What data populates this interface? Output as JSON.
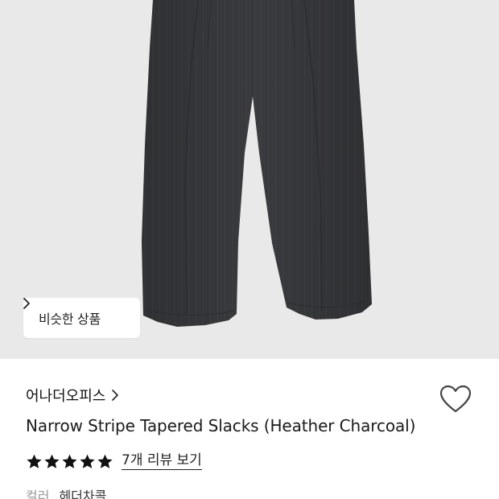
{
  "hero": {
    "similar_button_label": "비슷한 상품"
  },
  "product": {
    "brand": "어나더오피스",
    "title": "Narrow Stripe Tapered Slacks (Heather Charcoal)",
    "rating": 5,
    "review_link": "7개 리뷰 보기",
    "color_label": "컬러",
    "color_value": "헤더차콜"
  },
  "icons": {
    "similar_chevron": "chevron-right-icon",
    "brand_chevron": "chevron-right-icon",
    "wishlist": "heart-outline-icon",
    "star": "star-filled-icon"
  },
  "colors": {
    "hero_background": "#e9e9e9",
    "garment": "#3a3b3e",
    "text_primary": "#111111",
    "text_muted": "#999999"
  }
}
